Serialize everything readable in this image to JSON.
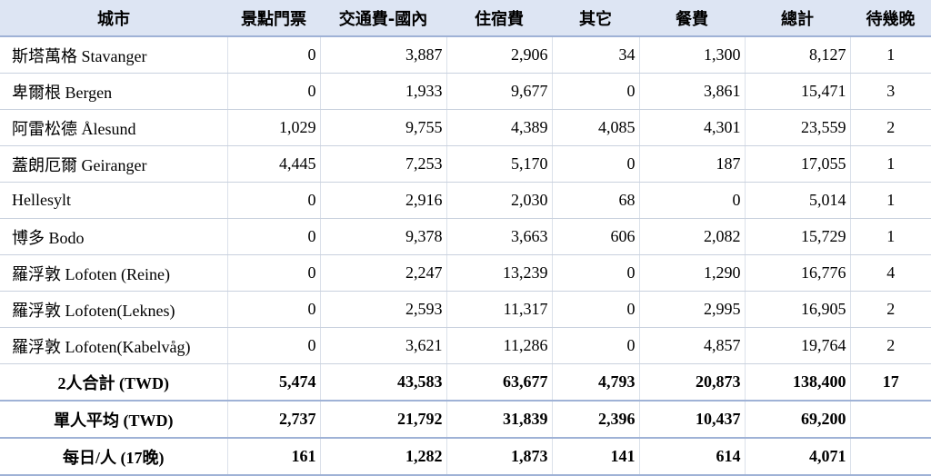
{
  "headers": [
    "城市",
    "景點門票",
    "交通費-國內",
    "住宿費",
    "其它",
    "餐費",
    "總計",
    "待幾晚"
  ],
  "rows": [
    {
      "city": "斯塔萬格 Stavanger",
      "tickets": "0",
      "transport": "3,887",
      "lodging": "2,906",
      "other": "34",
      "meals": "1,300",
      "total": "8,127",
      "nights": "1"
    },
    {
      "city": "卑爾根 Bergen",
      "tickets": "0",
      "transport": "1,933",
      "lodging": "9,677",
      "other": "0",
      "meals": "3,861",
      "total": "15,471",
      "nights": "3"
    },
    {
      "city": "阿雷松德 Ålesund",
      "tickets": "1,029",
      "transport": "9,755",
      "lodging": "4,389",
      "other": "4,085",
      "meals": "4,301",
      "total": "23,559",
      "nights": "2"
    },
    {
      "city": "蓋朗厄爾 Geiranger",
      "tickets": "4,445",
      "transport": "7,253",
      "lodging": "5,170",
      "other": "0",
      "meals": "187",
      "total": "17,055",
      "nights": "1"
    },
    {
      "city": "Hellesylt",
      "tickets": "0",
      "transport": "2,916",
      "lodging": "2,030",
      "other": "68",
      "meals": "0",
      "total": "5,014",
      "nights": "1"
    },
    {
      "city": "博多 Bodo",
      "tickets": "0",
      "transport": "9,378",
      "lodging": "3,663",
      "other": "606",
      "meals": "2,082",
      "total": "15,729",
      "nights": "1"
    },
    {
      "city": "羅浮敦 Lofoten (Reine)",
      "tickets": "0",
      "transport": "2,247",
      "lodging": "13,239",
      "other": "0",
      "meals": "1,290",
      "total": "16,776",
      "nights": "4"
    },
    {
      "city": "羅浮敦 Lofoten(Leknes)",
      "tickets": "0",
      "transport": "2,593",
      "lodging": "11,317",
      "other": "0",
      "meals": "2,995",
      "total": "16,905",
      "nights": "2"
    },
    {
      "city": "羅浮敦 Lofoten(Kabelvåg)",
      "tickets": "0",
      "transport": "3,621",
      "lodging": "11,286",
      "other": "0",
      "meals": "4,857",
      "total": "19,764",
      "nights": "2"
    }
  ],
  "summary": {
    "total": {
      "label": "2人合計 (TWD)",
      "tickets": "5,474",
      "transport": "43,583",
      "lodging": "63,677",
      "other": "4,793",
      "meals": "20,873",
      "total": "138,400",
      "nights": "17"
    },
    "avg": {
      "label": "單人平均 (TWD)",
      "tickets": "2,737",
      "transport": "21,792",
      "lodging": "31,839",
      "other": "2,396",
      "meals": "10,437",
      "total": "69,200",
      "nights": ""
    },
    "perday": {
      "label": "每日/人 (17晚)",
      "tickets": "161",
      "transport": "1,282",
      "lodging": "1,873",
      "other": "141",
      "meals": "614",
      "total": "4,071",
      "nights": ""
    }
  }
}
